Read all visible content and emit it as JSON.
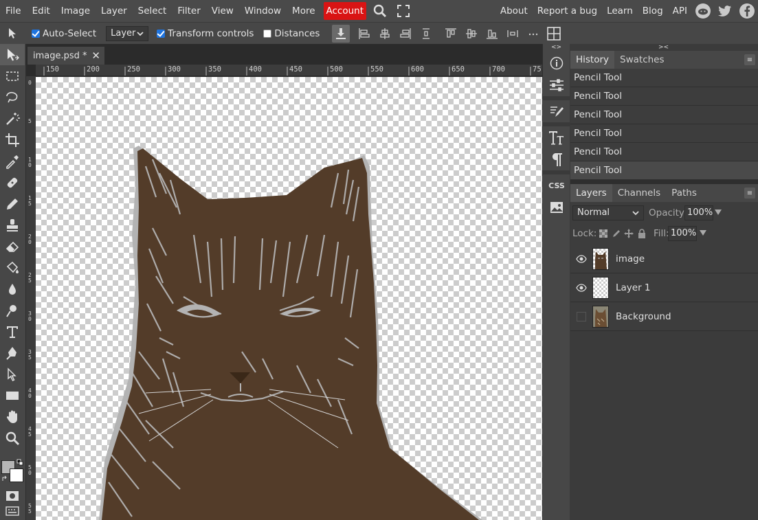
{
  "menu": {
    "items": [
      "File",
      "Edit",
      "Image",
      "Layer",
      "Select",
      "Filter",
      "View",
      "Window",
      "More"
    ],
    "account": "Account",
    "right_links": [
      "About",
      "Report a bug",
      "Learn",
      "Blog",
      "API"
    ],
    "accent_color": "#d91414"
  },
  "options": {
    "auto_select_label": "Auto-Select",
    "auto_select_checked": true,
    "target_value": "Layer",
    "transform_label": "Transform controls",
    "transform_checked": true,
    "distances_label": "Distances",
    "distances_checked": false
  },
  "tools": [
    "move-icon",
    "marquee-icon",
    "lasso-icon",
    "magic-wand-icon",
    "crop-icon",
    "eyedropper-icon",
    "healing-icon",
    "pencil-icon",
    "stamp-icon",
    "eraser-icon",
    "fill-icon",
    "blur-icon",
    "dodge-icon",
    "text-icon",
    "pen-icon",
    "path-select-icon",
    "shape-icon",
    "hand-icon",
    "zoom-icon"
  ],
  "colors": {
    "foreground": "#b5b5b5",
    "background": "#ffffff",
    "artwork": "#533c29",
    "artwork_light": "#b3b3b3"
  },
  "document": {
    "tab_title": "image.psd *",
    "ruler_h": [
      "150",
      "200",
      "250",
      "300",
      "350",
      "400",
      "450",
      "500",
      "550",
      "600",
      "650",
      "700",
      "75"
    ],
    "ruler_v": [
      "0",
      "5",
      "1 0",
      "1 5",
      "2 0",
      "2 5",
      "3 0",
      "3 5",
      "4 0",
      "4 5",
      "5 0",
      "5 5"
    ]
  },
  "history": {
    "tabs": [
      "History",
      "Swatches"
    ],
    "items": [
      "Pencil Tool",
      "Pencil Tool",
      "Pencil Tool",
      "Pencil Tool",
      "Pencil Tool",
      "Pencil Tool"
    ]
  },
  "layers": {
    "tabs": [
      "Layers",
      "Channels",
      "Paths"
    ],
    "blend_mode": "Normal",
    "opacity_label": "Opacity:",
    "opacity_value": "100%",
    "lock_label": "Lock:",
    "fill_label": "Fill:",
    "fill_value": "100%",
    "items": [
      {
        "name": "image",
        "visible": true
      },
      {
        "name": "Layer 1",
        "visible": true
      },
      {
        "name": "Background",
        "visible": false
      }
    ]
  },
  "strip": {
    "css_label": "CSS"
  }
}
